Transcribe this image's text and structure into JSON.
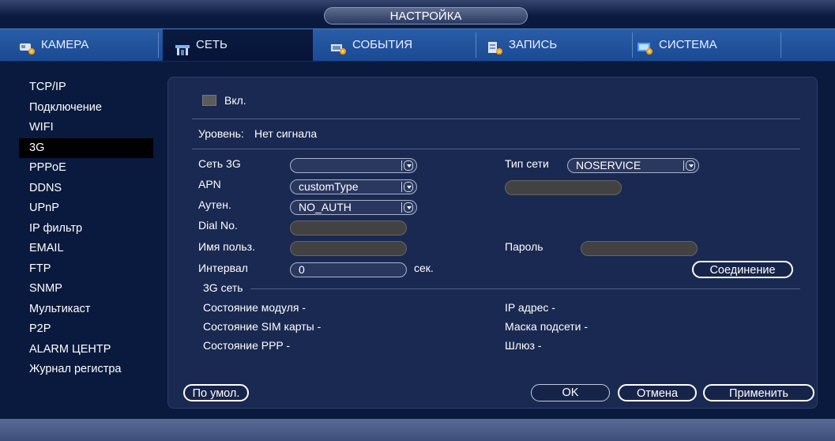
{
  "window": {
    "title": "НАСТРОЙКА"
  },
  "tabs": [
    {
      "label": "КАМЕРА",
      "icon": "camera-icon",
      "active": false
    },
    {
      "label": "СЕТЬ",
      "icon": "network-icon",
      "active": true
    },
    {
      "label": "СОБЫТИЯ",
      "icon": "events-icon",
      "active": false
    },
    {
      "label": "ЗАПИСЬ",
      "icon": "record-icon",
      "active": false
    },
    {
      "label": "СИСТЕМА",
      "icon": "system-icon",
      "active": false
    }
  ],
  "sidebar": {
    "items": [
      {
        "label": "TCP/IP"
      },
      {
        "label": "Подключение"
      },
      {
        "label": "WIFI"
      },
      {
        "label": "3G",
        "active": true
      },
      {
        "label": "PPPoE"
      },
      {
        "label": "DDNS"
      },
      {
        "label": "UPnP"
      },
      {
        "label": "IP фильтр"
      },
      {
        "label": "EMAIL"
      },
      {
        "label": "FTP"
      },
      {
        "label": "SNMP"
      },
      {
        "label": "Мультикаст"
      },
      {
        "label": "P2P"
      },
      {
        "label": "ALARM ЦЕНТР"
      },
      {
        "label": "Журнал регистра"
      }
    ]
  },
  "form": {
    "enable_label": "Вкл.",
    "enable_checked": false,
    "level_label": "Уровень:",
    "level_value": "Нет сигнала",
    "net3g_label": "Сеть 3G",
    "net3g_value": "",
    "net_type_label": "Тип сети",
    "net_type_value": "NOSERVICE",
    "apn_label": "APN",
    "apn_value": "customType",
    "apn_extra_value": "",
    "auth_label": "Аутен.",
    "auth_value": "NO_AUTH",
    "dial_label": "Dial No.",
    "dial_value": "",
    "user_label": "Имя польз.",
    "user_value": "",
    "password_label": "Пароль",
    "password_value": "",
    "interval_label": "Интервал",
    "interval_value": "0",
    "interval_unit": "сек.",
    "connect_button": "Соединение"
  },
  "status": {
    "section_title": "3G сеть",
    "module_state": "Состояние модуля -",
    "sim_state": "Состояние SIM карты -",
    "ppp_state": "Состояние PPP -",
    "ip_address": "IP адрес -",
    "subnet_mask": "Маска подсети -",
    "gateway": "Шлюз -"
  },
  "buttons": {
    "default": "По умол.",
    "ok": "OK",
    "cancel": "Отмена",
    "apply": "Применить"
  },
  "colors": {
    "background": "#0a1a3e",
    "tabbar": "#1a4a92",
    "panel": "#1a2952",
    "active_sidebar": "#000000"
  }
}
